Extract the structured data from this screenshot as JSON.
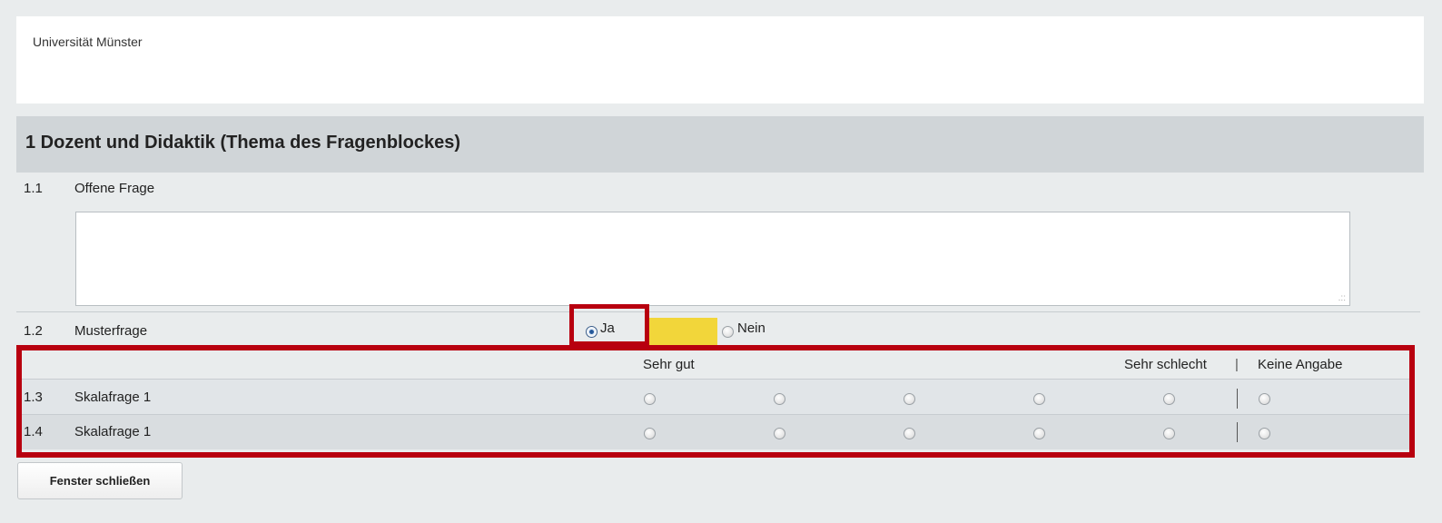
{
  "header": {
    "university": "Universität Münster"
  },
  "block": {
    "title": "1  Dozent und Didaktik (Thema des Fragenblockes)"
  },
  "questions": [
    {
      "num": "1.1",
      "text": "Offene Frage",
      "answer": ""
    },
    {
      "num": "1.2",
      "text": "Musterfrage",
      "options": [
        "Ja",
        "Nein"
      ],
      "selected": "Ja"
    },
    {
      "num": "1.3",
      "text": "Skalafrage 1"
    },
    {
      "num": "1.4",
      "text": "Skalafrage 1"
    }
  ],
  "scale": {
    "left_label": "Sehr gut",
    "right_label": "Sehr schlecht",
    "na_label": "Keine Angabe",
    "separator": "|"
  },
  "footer": {
    "close_label": "Fenster schließen"
  },
  "colors": {
    "highlight": "#b8000f",
    "yellow": "#f2d63a",
    "section_bar": "#d0d5d8"
  }
}
